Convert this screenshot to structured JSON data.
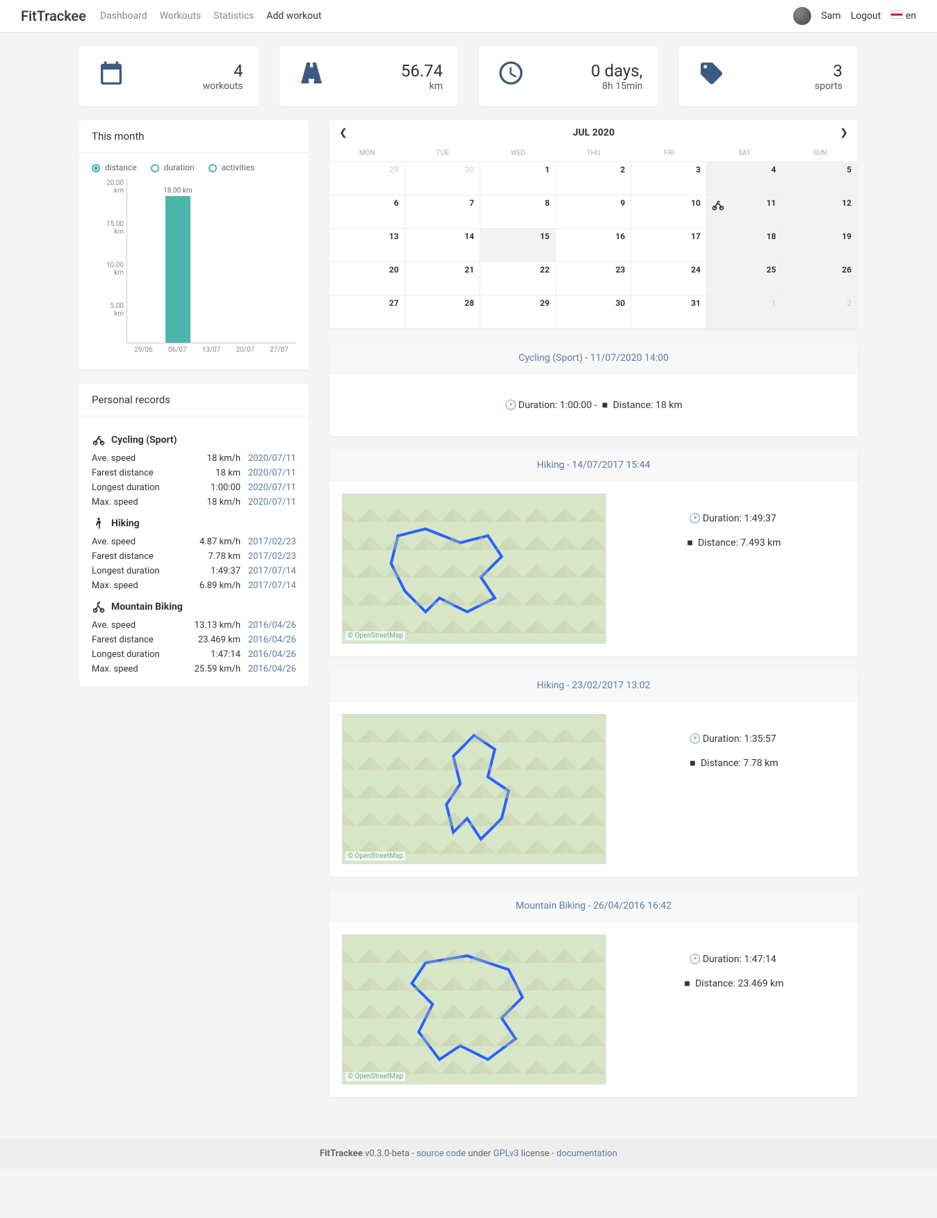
{
  "nav": {
    "brand": "FitTrackee",
    "links": [
      "Dashboard",
      "Workouts",
      "Statistics",
      "Add workout"
    ],
    "active_index": 3,
    "user": "Sam",
    "logout": "Logout",
    "lang": "en"
  },
  "stats": [
    {
      "icon": "calendar",
      "value": "4",
      "label": "workouts"
    },
    {
      "icon": "road",
      "value": "56.74",
      "label": "km"
    },
    {
      "icon": "clock",
      "value": "0 days,",
      "label": "8h 15min"
    },
    {
      "icon": "tags",
      "value": "3",
      "label": "sports"
    }
  ],
  "this_month": {
    "title": "This month",
    "controls": [
      "distance",
      "duration",
      "activities"
    ],
    "selected_control": 0
  },
  "chart_data": {
    "type": "bar",
    "categories": [
      "29/06",
      "06/07",
      "13/07",
      "20/07",
      "27/07"
    ],
    "values": [
      0,
      18.0,
      0,
      0,
      0
    ],
    "bar_label": "18.00 km",
    "ylim": [
      0,
      20
    ],
    "y_ticks": [
      "20.00 km",
      "15.00 km",
      "10.00 km",
      "5.00 km"
    ],
    "y_positions": [
      0,
      25,
      50,
      75
    ]
  },
  "records": {
    "title": "Personal records",
    "sports": [
      {
        "name": "Cycling (Sport)",
        "icon": "bike",
        "rows": [
          {
            "label": "Ave. speed",
            "value": "18 km/h",
            "date": "2020/07/11"
          },
          {
            "label": "Farest distance",
            "value": "18 km",
            "date": "2020/07/11"
          },
          {
            "label": "Longest duration",
            "value": "1:00:00",
            "date": "2020/07/11"
          },
          {
            "label": "Max. speed",
            "value": "18 km/h",
            "date": "2020/07/11"
          }
        ]
      },
      {
        "name": "Hiking",
        "icon": "hike",
        "rows": [
          {
            "label": "Ave. speed",
            "value": "4.87 km/h",
            "date": "2017/02/23"
          },
          {
            "label": "Farest distance",
            "value": "7.78 km",
            "date": "2017/02/23"
          },
          {
            "label": "Longest duration",
            "value": "1:49:37",
            "date": "2017/07/14"
          },
          {
            "label": "Max. speed",
            "value": "6.89 km/h",
            "date": "2017/07/14"
          }
        ]
      },
      {
        "name": "Mountain Biking",
        "icon": "mtb",
        "rows": [
          {
            "label": "Ave. speed",
            "value": "13.13 km/h",
            "date": "2016/04/26"
          },
          {
            "label": "Farest distance",
            "value": "23.469 km",
            "date": "2016/04/26"
          },
          {
            "label": "Longest duration",
            "value": "1:47:14",
            "date": "2016/04/26"
          },
          {
            "label": "Max. speed",
            "value": "25.59 km/h",
            "date": "2016/04/26"
          }
        ]
      }
    ]
  },
  "calendar": {
    "title": "JUL 2020",
    "day_headers": [
      "MON",
      "TUE",
      "WED",
      "THU",
      "FRI",
      "SAT",
      "SUN"
    ],
    "cells": [
      {
        "n": "29",
        "other": true
      },
      {
        "n": "30",
        "other": true
      },
      {
        "n": "1"
      },
      {
        "n": "2"
      },
      {
        "n": "3"
      },
      {
        "n": "4",
        "hl": true
      },
      {
        "n": "5",
        "hl": true
      },
      {
        "n": "6"
      },
      {
        "n": "7"
      },
      {
        "n": "8"
      },
      {
        "n": "9"
      },
      {
        "n": "10"
      },
      {
        "n": "11",
        "hl": true,
        "act": "bike"
      },
      {
        "n": "12",
        "hl": true
      },
      {
        "n": "13"
      },
      {
        "n": "14"
      },
      {
        "n": "15",
        "hl": true
      },
      {
        "n": "16"
      },
      {
        "n": "17"
      },
      {
        "n": "18",
        "hl": true
      },
      {
        "n": "19",
        "hl": true
      },
      {
        "n": "20"
      },
      {
        "n": "21"
      },
      {
        "n": "22"
      },
      {
        "n": "23"
      },
      {
        "n": "24"
      },
      {
        "n": "25",
        "hl": true
      },
      {
        "n": "26",
        "hl": true
      },
      {
        "n": "27"
      },
      {
        "n": "28"
      },
      {
        "n": "29"
      },
      {
        "n": "30"
      },
      {
        "n": "31"
      },
      {
        "n": "1",
        "other": true,
        "hl": true
      },
      {
        "n": "2",
        "other": true,
        "hl": true
      }
    ]
  },
  "workouts": [
    {
      "title": "Cycling (Sport) - 11/07/2020 14:00",
      "map": false,
      "duration_label": "Duration:",
      "duration": "1:00:00",
      "sep": " - ",
      "distance_label": "Distance:",
      "distance": "18 km"
    },
    {
      "title": "Hiking - 14/07/2017 15:44",
      "map": true,
      "osm": "© OpenStreetMap",
      "duration_label": "Duration:",
      "duration": "1:49:37",
      "distance_label": "Distance:",
      "distance": "7.493 km"
    },
    {
      "title": "Hiking - 23/02/2017 13:02",
      "map": true,
      "osm": "© OpenStreetMap",
      "duration_label": "Duration:",
      "duration": "1:35:57",
      "distance_label": "Distance:",
      "distance": "7.78 km"
    },
    {
      "title": "Mountain Biking - 26/04/2016 16:42",
      "map": true,
      "osm": "© OpenStreetMap",
      "duration_label": "Duration:",
      "duration": "1:47:14",
      "distance_label": "Distance:",
      "distance": "23.469 km"
    }
  ],
  "footer": {
    "brand": "FitTrackee",
    "version": " v0.3.0-beta - ",
    "source": "source code",
    "under": " under ",
    "license": "GPLv3",
    "license_suffix": " license - ",
    "docs": "documentation"
  }
}
